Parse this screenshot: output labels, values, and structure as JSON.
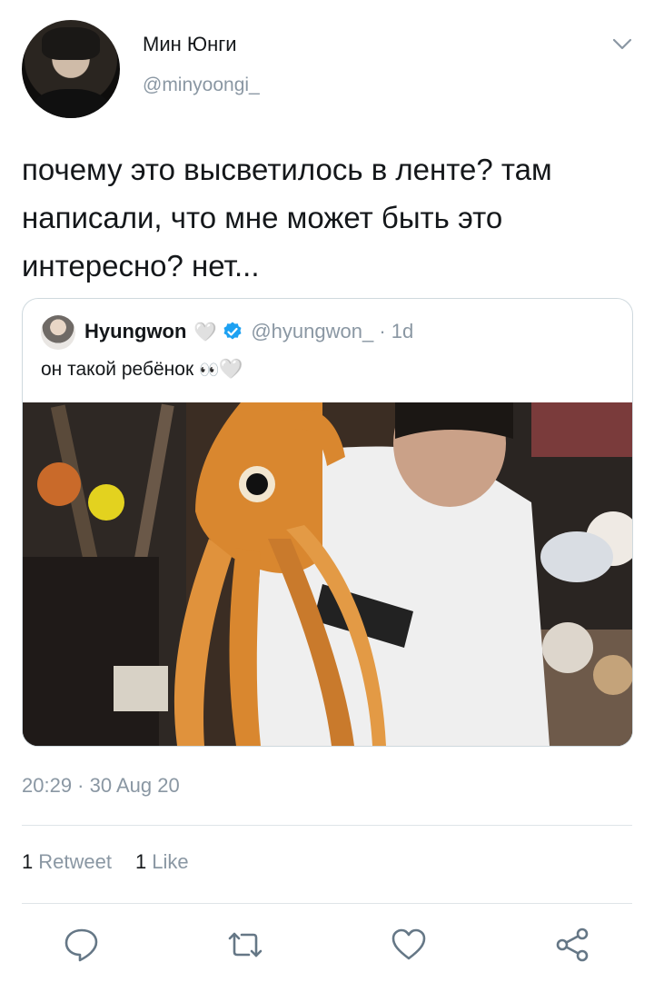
{
  "author": {
    "display_name": "Мин Юнги",
    "handle": "@minyoongi_"
  },
  "tweet": {
    "text": "почему это высветилось в ленте? там написали, что мне может быть это интересно? нет...",
    "timestamp": "20:29 · 30 Aug 20"
  },
  "quoted_tweet": {
    "display_name": "Hyungwon",
    "name_emoji": "🤍",
    "handle_time": "@hyungwon_ · 1d",
    "text": "он такой ребёнок",
    "text_emoji": "👀",
    "text_heart": "🤍",
    "verified": true
  },
  "stats": {
    "retweets_count": "1",
    "retweets_label": "Retweet",
    "likes_count": "1",
    "likes_label": "Like"
  },
  "icons": {
    "menu": "chevron-down-icon",
    "reply": "reply-icon",
    "retweet": "retweet-icon",
    "like": "heart-icon",
    "share": "share-icon",
    "verified": "verified-badge-icon"
  },
  "colors": {
    "secondary_text": "#8a97a3",
    "icon_stroke": "#657786",
    "verified": "#1da1f2"
  }
}
